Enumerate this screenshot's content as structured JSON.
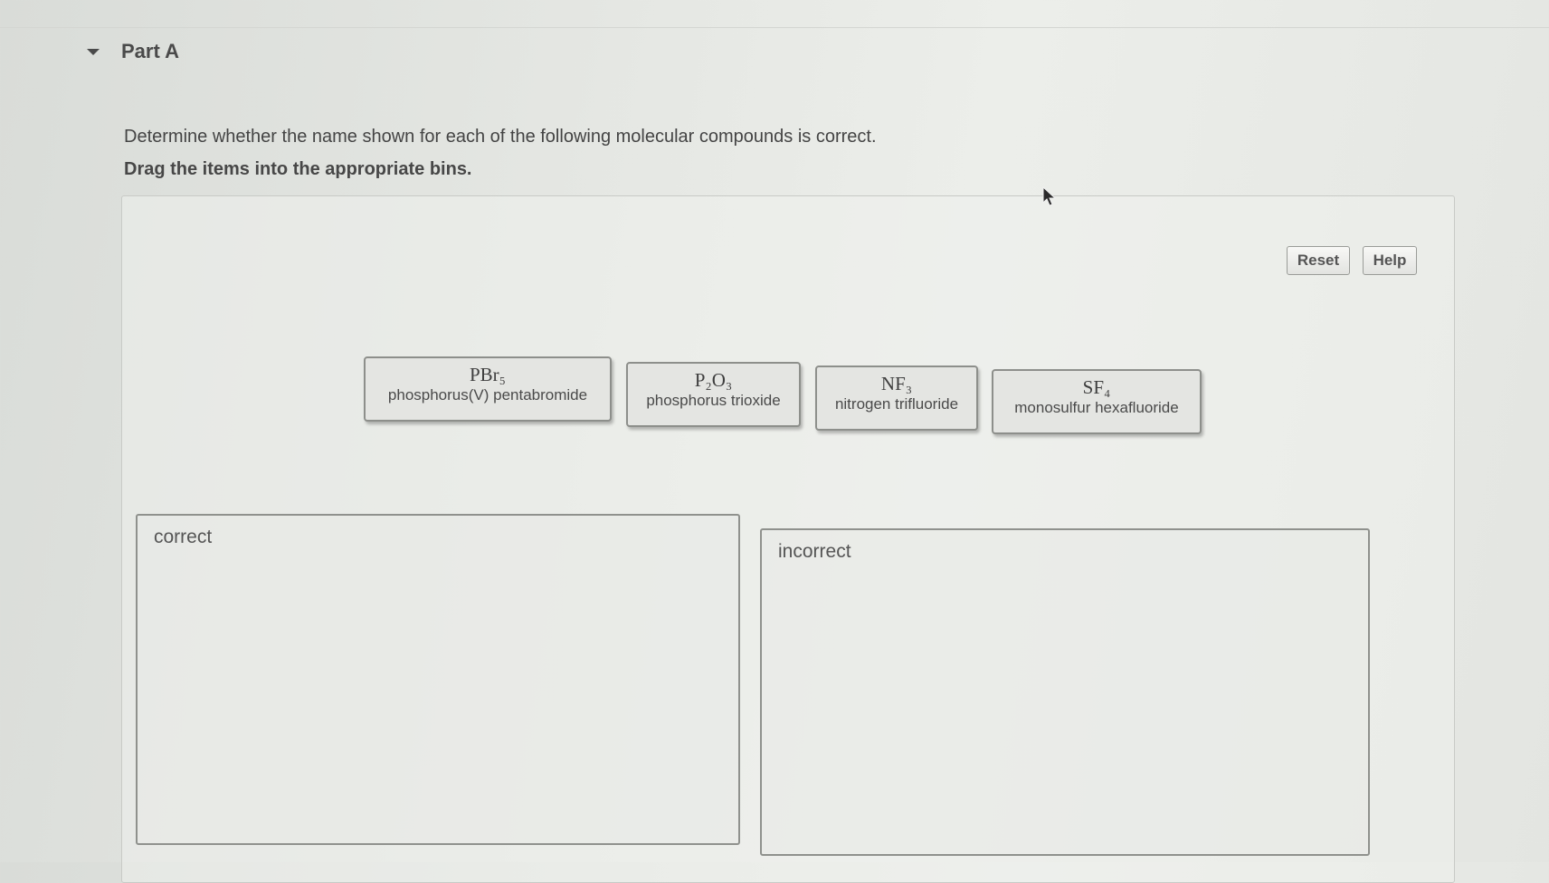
{
  "part": {
    "title": "Part A"
  },
  "instructions": {
    "line1": "Determine whether the name shown for each of the following molecular compounds is correct.",
    "line2": "Drag the items into the appropriate bins."
  },
  "toolbar": {
    "reset_label": "Reset",
    "help_label": "Help"
  },
  "items": [
    {
      "formula": "PBr₅",
      "name": "phosphorus(V) pentabromide"
    },
    {
      "formula": "P₂O₃",
      "name": "phosphorus trioxide"
    },
    {
      "formula": "NF₃",
      "name": "nitrogen trifluoride"
    },
    {
      "formula": "SF₄",
      "name": "monosulfur hexafluoride"
    }
  ],
  "bins": [
    {
      "label": "correct"
    },
    {
      "label": "incorrect"
    }
  ],
  "icons": {
    "part_toggle": "caret-down-icon",
    "pointer": "mouse-cursor-icon"
  }
}
